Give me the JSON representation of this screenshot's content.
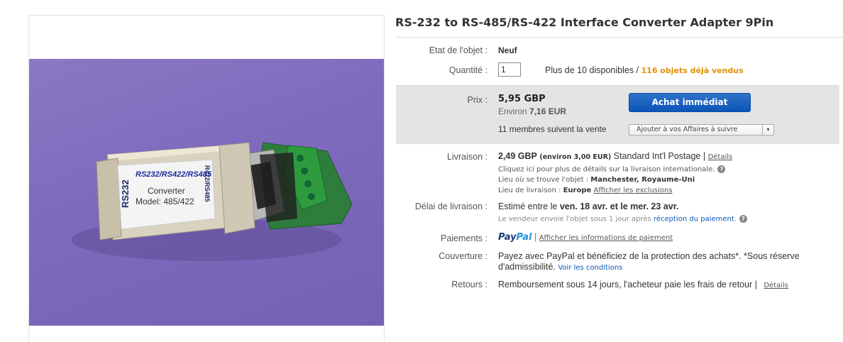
{
  "item": {
    "title": "RS-232 to RS-485/RS-422 Interface Converter Adapter 9Pin",
    "photo_labels": {
      "rs232": "RS232",
      "models": "RS232/RS422/RS485",
      "converter": "Converter",
      "model": "Model: 485/422",
      "side": "R422/RS485"
    }
  },
  "condition": {
    "label": "Etat de l'objet :",
    "value": "Neuf"
  },
  "quantity": {
    "label": "Quantité :",
    "value": "1",
    "available": "Plus de 10 disponibles /",
    "sold": "116 objets déjà vendus"
  },
  "price": {
    "label": "Prix :",
    "value": "5,95 GBP",
    "approx_prefix": "Environ",
    "approx_value": "7,16 EUR",
    "buy_button": "Achat immédiat",
    "watchers": "11 membres suivent la vente",
    "watch_button": "Ajouter à vos Affaires à suivre",
    "watch_caret": "▾"
  },
  "shipping": {
    "label": "Livraison :",
    "cost": "2,49 GBP",
    "approx": "(environ 3,00 EUR)",
    "service": "Standard Int'l Postage |",
    "details": "Détails",
    "intl_note": "Cliquez ici pour plus de détails sur la livraison internationale.",
    "location_label": "Lieu où se trouve l'objet :",
    "location_value": "Manchester, Royaume-Uni",
    "ship_to_label": "Lieu de livraison :",
    "ship_to_value": "Europe",
    "exclusions": "Afficher les exclusions"
  },
  "delivery": {
    "label": "Délai de livraison :",
    "prefix": "Estimé entre le",
    "dates": "ven. 18 avr. et le mer. 23 avr.",
    "note": "Le vendeur envoie l'objet sous 1 jour après",
    "note_link": "réception du paiement",
    "note_end": "."
  },
  "payments": {
    "label": "Paiements :",
    "paypal_a": "Pay",
    "paypal_b": "Pal",
    "sep": "|",
    "info": "Afficher les informations de paiement"
  },
  "coverage": {
    "label": "Couverture :",
    "line1": "Payez avec PayPal et bénéficiez de la protection des achats*. *Sous réserve",
    "line2": "d'admissibilité.",
    "link": "Voir les conditions"
  },
  "returns": {
    "label": "Retours :",
    "text": "Remboursement sous 14 jours, l'acheteur paie les frais de retour |",
    "details": "Détails"
  },
  "help_glyph": "?",
  "colors": {
    "accent": "#0654ba",
    "sold": "#e38f00",
    "button": "#0b55b8",
    "price_bg": "#e4e4e4"
  }
}
